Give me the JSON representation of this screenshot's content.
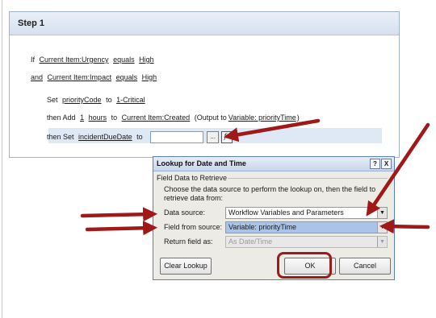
{
  "step": {
    "title": "Step 1",
    "if_line": {
      "kw_if": "If",
      "field": "Current Item:Urgency",
      "op": "equals",
      "value": "High"
    },
    "and_line": {
      "kw_and": "and",
      "field": "Current Item:Impact",
      "op": "equals",
      "value": "High"
    },
    "set_line": {
      "kw": "Set",
      "var": "priorityCode",
      "to": "to",
      "value": "1-Critical"
    },
    "add_line": {
      "kw": "then Add",
      "num": "1",
      "unit": "hours",
      "to": "to",
      "field": "Current Item:Created",
      "output_pre": "(Output to",
      "output_var": "Variable: priorityTime",
      "output_post": ")"
    },
    "set2_line": {
      "kw": "then Set",
      "var": "incidentDueDate",
      "to": "to",
      "ellipsis": "...",
      "fx": "fx"
    }
  },
  "dialog": {
    "title": "Lookup for Date and Time",
    "help": "?",
    "close": "X",
    "group": "Field Data to Retrieve",
    "description": "Choose the data source to perform the lookup on, then the field to retrieve data from:",
    "data_source_label": "Data source:",
    "data_source_value": "Workflow Variables and Parameters",
    "field_label": "Field from source:",
    "field_value": "Variable: priorityTime",
    "return_label": "Return field as:",
    "return_value": "As Date/Time",
    "clear_button": "Clear Lookup",
    "ok_button": "OK",
    "cancel_button": "Cancel"
  },
  "colors": {
    "annotation_arrow": "#a01818",
    "selection": "#aac3e8"
  },
  "icons": {
    "dropdown": "triangle-down",
    "arrows": "red-annotation-arrow"
  }
}
